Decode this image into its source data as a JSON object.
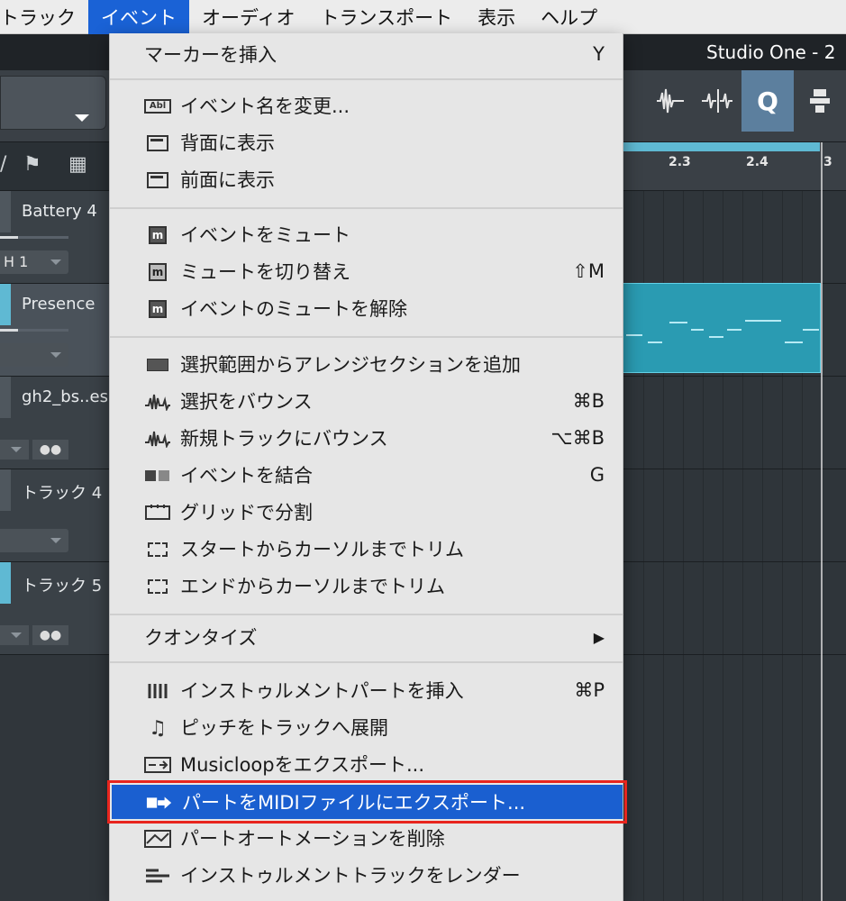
{
  "menubar": {
    "items": [
      "トラック",
      "イベント",
      "オーディオ",
      "トランスポート",
      "表示",
      "ヘルプ"
    ],
    "active_index": 1
  },
  "window": {
    "title": "Studio One - 2"
  },
  "tracks": [
    {
      "name": "Battery 4",
      "channel": "H 1"
    },
    {
      "name": "Presence"
    },
    {
      "name": "gh2_bs..es"
    },
    {
      "name": "トラック 4"
    },
    {
      "name": "トラック 5"
    }
  ],
  "ruler": {
    "ticks": [
      "2.3",
      "2.4",
      "3"
    ]
  },
  "toolbar": {
    "quantize_label": "Q"
  },
  "menu": {
    "items": [
      {
        "label": "マーカーを挿入",
        "shortcut": "Y",
        "icon": "none"
      },
      {
        "label": "イベント名を変更...",
        "shortcut": "",
        "icon": "rename-icon"
      },
      {
        "label": "背面に表示",
        "shortcut": "",
        "icon": "send-back-icon"
      },
      {
        "label": "前面に表示",
        "shortcut": "",
        "icon": "bring-front-icon"
      },
      {
        "label": "イベントをミュート",
        "shortcut": "",
        "icon": "mute-icon"
      },
      {
        "label": "ミュートを切り替え",
        "shortcut": "⇧M",
        "icon": "toggle-mute-icon"
      },
      {
        "label": "イベントのミュートを解除",
        "shortcut": "",
        "icon": "unmute-icon"
      },
      {
        "label": "選択範囲からアレンジセクションを追加",
        "shortcut": "",
        "icon": "arrange-section-icon"
      },
      {
        "label": "選択をバウンス",
        "shortcut": "⌘B",
        "icon": "bounce-icon"
      },
      {
        "label": "新規トラックにバウンス",
        "shortcut": "⌥⌘B",
        "icon": "bounce-new-track-icon"
      },
      {
        "label": "イベントを結合",
        "shortcut": "G",
        "icon": "merge-icon"
      },
      {
        "label": "グリッドで分割",
        "shortcut": "",
        "icon": "split-grid-icon"
      },
      {
        "label": "スタートからカーソルまでトリム",
        "shortcut": "",
        "icon": "trim-start-icon"
      },
      {
        "label": "エンドからカーソルまでトリム",
        "shortcut": "",
        "icon": "trim-end-icon"
      },
      {
        "label": "クオンタイズ",
        "shortcut": "▶",
        "icon": "none"
      },
      {
        "label": "インストゥルメントパートを挿入",
        "shortcut": "⌘P",
        "icon": "instrument-part-icon"
      },
      {
        "label": "ピッチをトラックへ展開",
        "shortcut": "",
        "icon": "note-icon"
      },
      {
        "label": "Musicloopをエクスポート...",
        "shortcut": "",
        "icon": "musicloop-icon"
      },
      {
        "label": "パートをMIDIファイルにエクスポート...",
        "shortcut": "",
        "icon": "export-midi-icon"
      },
      {
        "label": "パートオートメーションを削除",
        "shortcut": "",
        "icon": "automation-icon"
      },
      {
        "label": "インストゥルメントトラックをレンダー",
        "shortcut": "",
        "icon": "render-icon"
      }
    ]
  }
}
